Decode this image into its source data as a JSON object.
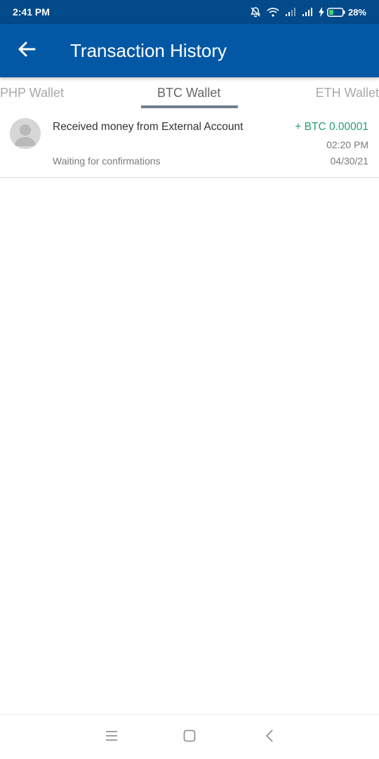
{
  "status_bar": {
    "time": "2:41 PM",
    "battery": "28%",
    "icons": [
      "mute-icon",
      "wifi-icon",
      "signal-icon",
      "signal-icon",
      "charging-icon",
      "battery-icon"
    ]
  },
  "header": {
    "title": "Transaction History",
    "back_icon": "back-arrow-icon"
  },
  "tabs": [
    {
      "label": "PHP Wallet",
      "active": false
    },
    {
      "label": "BTC Wallet",
      "active": true
    },
    {
      "label": "ETH Wallet",
      "active": false
    }
  ],
  "transactions": [
    {
      "description": "Received money from External Account",
      "amount": "+ BTC 0.00001",
      "time": "02:20 PM",
      "date": "04/30/21",
      "status": "Waiting for confirmations",
      "avatar_icon": "user-avatar-icon"
    }
  ],
  "nav": {
    "icons": [
      "menu-icon",
      "home-icon",
      "back-icon"
    ]
  },
  "colors": {
    "app_bar": "#0358a6",
    "status_bar": "#024a8a",
    "amount_positive": "#2a9d6f"
  }
}
